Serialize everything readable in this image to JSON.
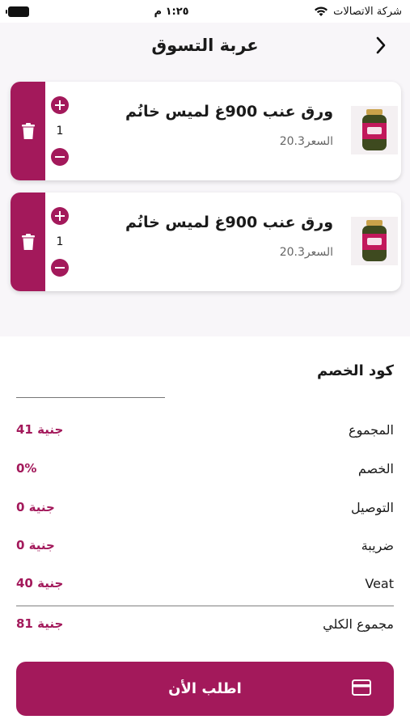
{
  "status_bar": {
    "carrier": "شركة الاتصالات",
    "time": "١:٢٥ م"
  },
  "header": {
    "title": "عربة التسوق",
    "back_icon": "chevron-right-icon"
  },
  "cart_items": [
    {
      "name": "ورق عنب 900غ لميس خانُم",
      "price": "السعر20.3",
      "quantity": "1",
      "image_icon": "jar-icon"
    },
    {
      "name": "ورق عنب 900غ لميس خانُم",
      "price": "السعر20.3",
      "quantity": "1",
      "image_icon": "jar-icon"
    }
  ],
  "discount": {
    "label": "كود الخصم",
    "placeholder": ""
  },
  "summary": {
    "subtotal_label": "المجموع",
    "subtotal_value": "جنية 41",
    "discount_label": "الخصم",
    "discount_value": "0%",
    "delivery_label": "التوصيل",
    "delivery_value": "جنية 0",
    "tax_label": "ضريبة",
    "tax_value": "جنية 0",
    "vat_label": "Veat",
    "vat_value": "جنية 40",
    "total_label": "مجموع الكلي",
    "total_value": "جنية 81"
  },
  "order_button": {
    "label": "اطلب الأن",
    "icon": "credit-card-icon"
  },
  "colors": {
    "accent": "#a3195b",
    "background_top": "#f8f6f9"
  }
}
